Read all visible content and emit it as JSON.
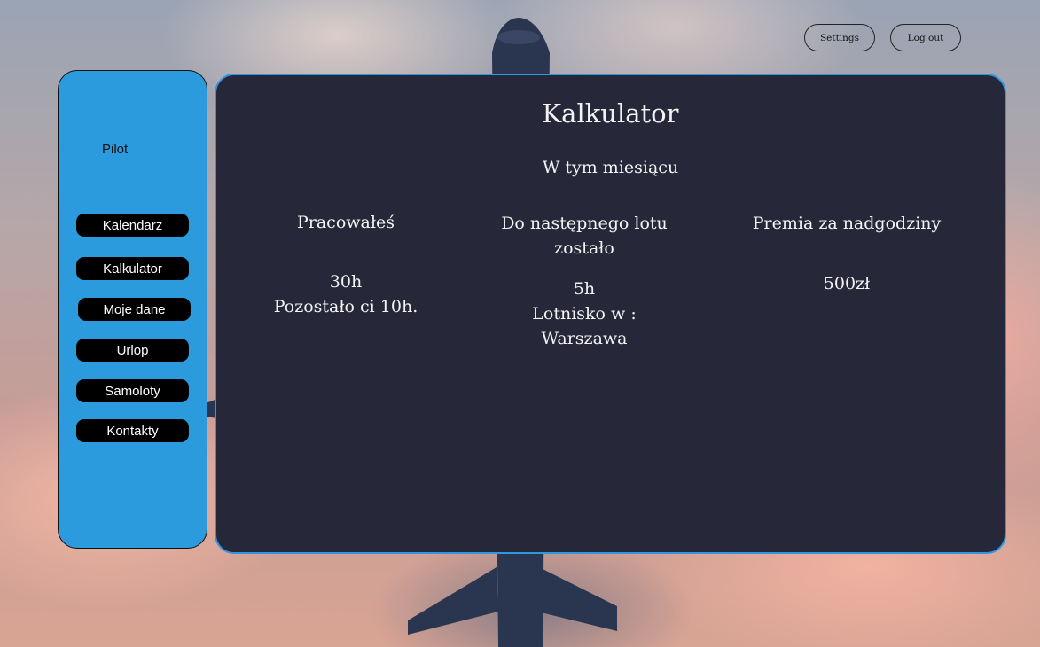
{
  "header": {
    "settings_label": "Settings",
    "logout_label": "Log out"
  },
  "sidebar": {
    "title": "Pilot",
    "items": [
      {
        "label": "Kalendarz"
      },
      {
        "label": "Kalkulator"
      },
      {
        "label": "Moje dane"
      },
      {
        "label": "Urlop"
      },
      {
        "label": "Samoloty"
      },
      {
        "label": "Kontakty"
      }
    ]
  },
  "main": {
    "title": "Kalkulator",
    "subtitle": "W tym miesiącu",
    "columns": [
      {
        "heading": "Pracowałeś",
        "value_lines": [
          "30h",
          "Pozostało ci 10h."
        ]
      },
      {
        "heading_lines": [
          "Do następnego lotu",
          "zostało"
        ],
        "value_lines": [
          "5h",
          "Lotnisko w :",
          "Warszawa"
        ]
      },
      {
        "heading": "Premia za nadgodziny",
        "value_lines": [
          "500zł"
        ]
      }
    ]
  },
  "colors": {
    "sidebar_bg": "#2c9bdd",
    "panel_bg": "#262839",
    "panel_border": "#2e96e2",
    "nav_button_bg": "#000000"
  }
}
